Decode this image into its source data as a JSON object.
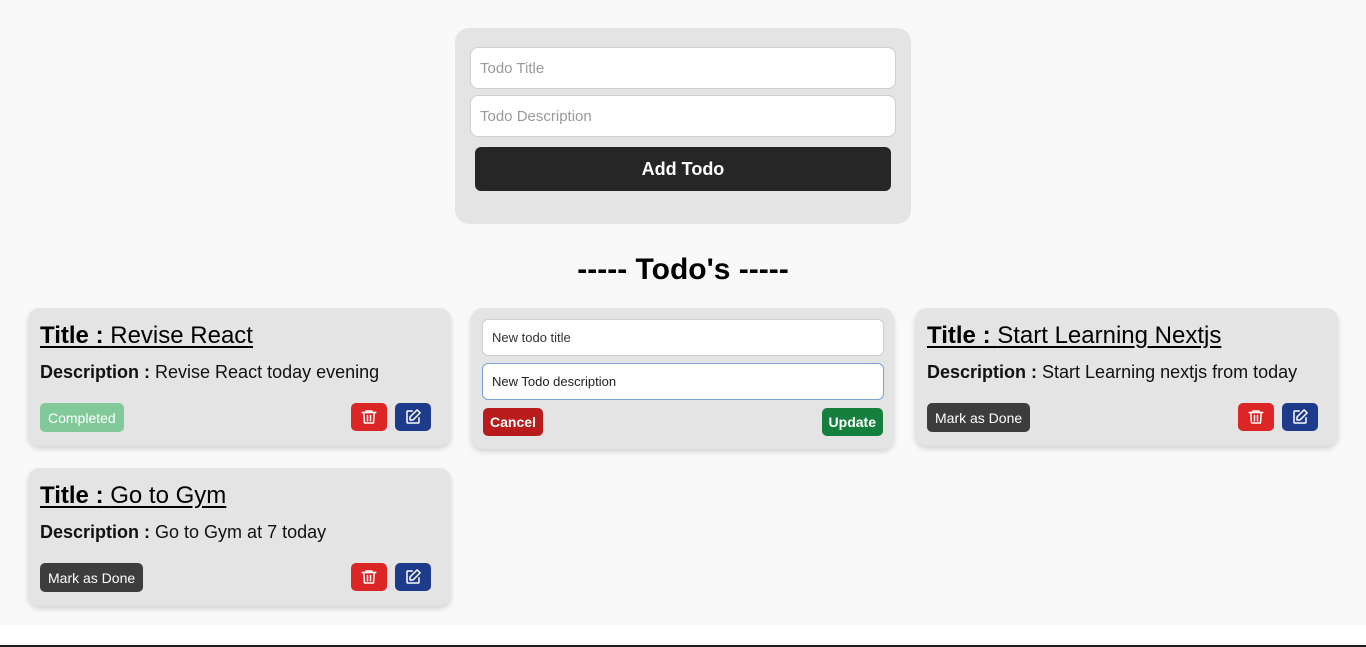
{
  "add_form": {
    "title_placeholder": "Todo Title",
    "description_placeholder": "Todo Description",
    "add_label": "Add Todo"
  },
  "heading": "----- Todo's -----",
  "labels": {
    "title": "Title :",
    "description": "Description :"
  },
  "todos": [
    {
      "title": "Revise React",
      "description": "Revise React today evening",
      "status_label": "Completed",
      "completed": true
    },
    {
      "title": "Start Learning Nextjs",
      "description": "Start Learning nextjs from today",
      "status_label": "Mark as Done",
      "completed": false
    },
    {
      "title": "Go to Gym",
      "description": "Go to Gym at 7 today",
      "status_label": "Mark as Done",
      "completed": false
    }
  ],
  "edit_form": {
    "title_placeholder": "New todo title",
    "description_value": "New Todo description",
    "cancel_label": "Cancel",
    "update_label": "Update"
  },
  "icons": {
    "delete": "trash-icon",
    "edit": "edit-icon"
  },
  "colors": {
    "completed": "#82c99a",
    "pending": "#3d3d3d",
    "delete": "#dc2626",
    "edit": "#1e3a8a",
    "cancel": "#b91c1c",
    "update": "#15803d"
  }
}
